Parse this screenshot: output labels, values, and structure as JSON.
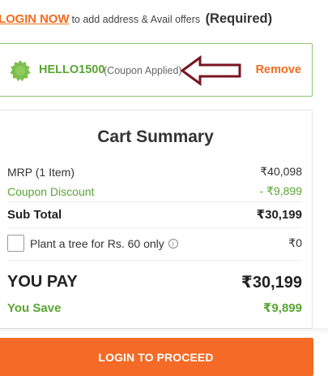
{
  "login_banner": {
    "link_text": "LOGIN NOW",
    "description": "to add address & Avail offers",
    "required": "(Required)"
  },
  "coupon": {
    "code": "HELLO1500",
    "status": "(Coupon Applied)",
    "remove_label": "Remove",
    "icon": "badge-icon",
    "arrow_icon": "arrow-left-icon"
  },
  "cart_summary": {
    "title": "Cart Summary",
    "mrp_label": "MRP (1 Item)",
    "mrp_value": "₹40,098",
    "discount_label": "Coupon Discount",
    "discount_value": "- ₹9,899",
    "subtotal_label": "Sub Total",
    "subtotal_value": "₹30,199",
    "tree_label": "Plant a tree for Rs. 60 only",
    "tree_value": "₹0",
    "info_icon_glyph": "i",
    "pay_label": "YOU PAY",
    "pay_value": "₹30,199",
    "save_label": "You Save",
    "save_value": "₹9,899"
  },
  "proceed_label": "LOGIN TO PROCEED",
  "colors": {
    "accent_orange": "#f26b1d",
    "success_green": "#5aa532",
    "arrow_maroon": "#7a1420"
  }
}
